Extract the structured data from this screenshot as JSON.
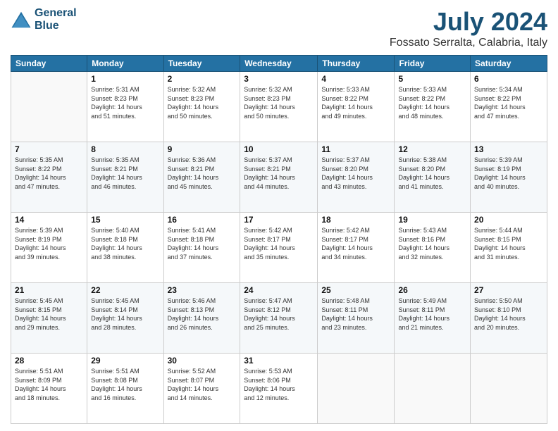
{
  "logo": {
    "line1": "General",
    "line2": "Blue"
  },
  "title": "July 2024",
  "subtitle": "Fossato Serralta, Calabria, Italy",
  "header_days": [
    "Sunday",
    "Monday",
    "Tuesday",
    "Wednesday",
    "Thursday",
    "Friday",
    "Saturday"
  ],
  "weeks": [
    [
      {
        "day": "",
        "info": ""
      },
      {
        "day": "1",
        "info": "Sunrise: 5:31 AM\nSunset: 8:23 PM\nDaylight: 14 hours\nand 51 minutes."
      },
      {
        "day": "2",
        "info": "Sunrise: 5:32 AM\nSunset: 8:23 PM\nDaylight: 14 hours\nand 50 minutes."
      },
      {
        "day": "3",
        "info": "Sunrise: 5:32 AM\nSunset: 8:23 PM\nDaylight: 14 hours\nand 50 minutes."
      },
      {
        "day": "4",
        "info": "Sunrise: 5:33 AM\nSunset: 8:22 PM\nDaylight: 14 hours\nand 49 minutes."
      },
      {
        "day": "5",
        "info": "Sunrise: 5:33 AM\nSunset: 8:22 PM\nDaylight: 14 hours\nand 48 minutes."
      },
      {
        "day": "6",
        "info": "Sunrise: 5:34 AM\nSunset: 8:22 PM\nDaylight: 14 hours\nand 47 minutes."
      }
    ],
    [
      {
        "day": "7",
        "info": "Sunrise: 5:35 AM\nSunset: 8:22 PM\nDaylight: 14 hours\nand 47 minutes."
      },
      {
        "day": "8",
        "info": "Sunrise: 5:35 AM\nSunset: 8:21 PM\nDaylight: 14 hours\nand 46 minutes."
      },
      {
        "day": "9",
        "info": "Sunrise: 5:36 AM\nSunset: 8:21 PM\nDaylight: 14 hours\nand 45 minutes."
      },
      {
        "day": "10",
        "info": "Sunrise: 5:37 AM\nSunset: 8:21 PM\nDaylight: 14 hours\nand 44 minutes."
      },
      {
        "day": "11",
        "info": "Sunrise: 5:37 AM\nSunset: 8:20 PM\nDaylight: 14 hours\nand 43 minutes."
      },
      {
        "day": "12",
        "info": "Sunrise: 5:38 AM\nSunset: 8:20 PM\nDaylight: 14 hours\nand 41 minutes."
      },
      {
        "day": "13",
        "info": "Sunrise: 5:39 AM\nSunset: 8:19 PM\nDaylight: 14 hours\nand 40 minutes."
      }
    ],
    [
      {
        "day": "14",
        "info": "Sunrise: 5:39 AM\nSunset: 8:19 PM\nDaylight: 14 hours\nand 39 minutes."
      },
      {
        "day": "15",
        "info": "Sunrise: 5:40 AM\nSunset: 8:18 PM\nDaylight: 14 hours\nand 38 minutes."
      },
      {
        "day": "16",
        "info": "Sunrise: 5:41 AM\nSunset: 8:18 PM\nDaylight: 14 hours\nand 37 minutes."
      },
      {
        "day": "17",
        "info": "Sunrise: 5:42 AM\nSunset: 8:17 PM\nDaylight: 14 hours\nand 35 minutes."
      },
      {
        "day": "18",
        "info": "Sunrise: 5:42 AM\nSunset: 8:17 PM\nDaylight: 14 hours\nand 34 minutes."
      },
      {
        "day": "19",
        "info": "Sunrise: 5:43 AM\nSunset: 8:16 PM\nDaylight: 14 hours\nand 32 minutes."
      },
      {
        "day": "20",
        "info": "Sunrise: 5:44 AM\nSunset: 8:15 PM\nDaylight: 14 hours\nand 31 minutes."
      }
    ],
    [
      {
        "day": "21",
        "info": "Sunrise: 5:45 AM\nSunset: 8:15 PM\nDaylight: 14 hours\nand 29 minutes."
      },
      {
        "day": "22",
        "info": "Sunrise: 5:45 AM\nSunset: 8:14 PM\nDaylight: 14 hours\nand 28 minutes."
      },
      {
        "day": "23",
        "info": "Sunrise: 5:46 AM\nSunset: 8:13 PM\nDaylight: 14 hours\nand 26 minutes."
      },
      {
        "day": "24",
        "info": "Sunrise: 5:47 AM\nSunset: 8:12 PM\nDaylight: 14 hours\nand 25 minutes."
      },
      {
        "day": "25",
        "info": "Sunrise: 5:48 AM\nSunset: 8:11 PM\nDaylight: 14 hours\nand 23 minutes."
      },
      {
        "day": "26",
        "info": "Sunrise: 5:49 AM\nSunset: 8:11 PM\nDaylight: 14 hours\nand 21 minutes."
      },
      {
        "day": "27",
        "info": "Sunrise: 5:50 AM\nSunset: 8:10 PM\nDaylight: 14 hours\nand 20 minutes."
      }
    ],
    [
      {
        "day": "28",
        "info": "Sunrise: 5:51 AM\nSunset: 8:09 PM\nDaylight: 14 hours\nand 18 minutes."
      },
      {
        "day": "29",
        "info": "Sunrise: 5:51 AM\nSunset: 8:08 PM\nDaylight: 14 hours\nand 16 minutes."
      },
      {
        "day": "30",
        "info": "Sunrise: 5:52 AM\nSunset: 8:07 PM\nDaylight: 14 hours\nand 14 minutes."
      },
      {
        "day": "31",
        "info": "Sunrise: 5:53 AM\nSunset: 8:06 PM\nDaylight: 14 hours\nand 12 minutes."
      },
      {
        "day": "",
        "info": ""
      },
      {
        "day": "",
        "info": ""
      },
      {
        "day": "",
        "info": ""
      }
    ]
  ]
}
